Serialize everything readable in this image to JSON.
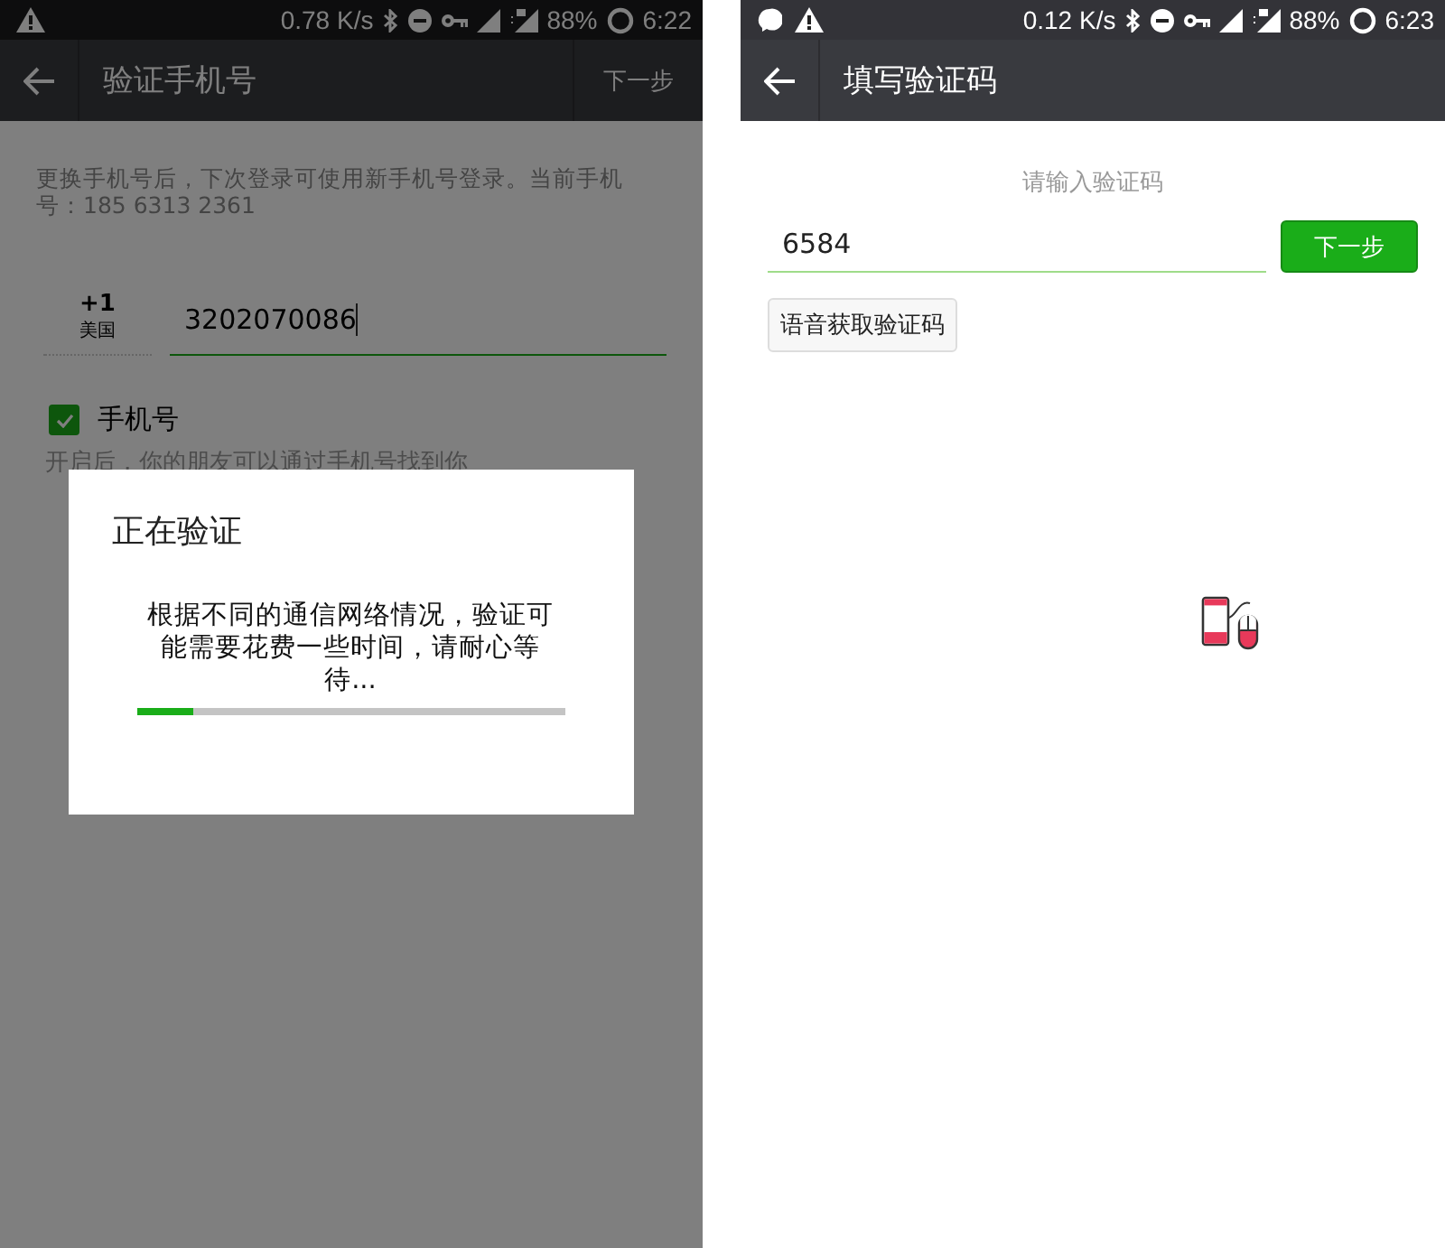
{
  "screens": [
    {
      "status_bar": {
        "speed": "0.78 K/s",
        "battery": "88%",
        "time": "6:22"
      },
      "toolbar": {
        "title": "验证手机号",
        "action": "下一步"
      },
      "description": "更换手机号后，下次登录可使用新手机号登录。当前手机号：185 6313 2361",
      "country": {
        "code": "+1",
        "name": "美国"
      },
      "phone_field": {
        "value": "3202070086"
      },
      "checkbox": {
        "label": "手机号",
        "checked": true
      },
      "hint": "开启后，你的朋友可以通过手机号找到你",
      "dialog": {
        "title": "正在验证",
        "message": "根据不同的通信网络情况，验证可能需要花费一些时间，请耐心等待...",
        "level": 0.13
      }
    },
    {
      "status_bar": {
        "speed": "0.12 K/s",
        "battery": "88%",
        "time": "6:23"
      },
      "toolbar": {
        "title": "填写验证码"
      },
      "prompt": "请输入验证码",
      "code_field": {
        "value": "6584"
      },
      "next_button": "下一步",
      "voice_button": "语音获取验证码"
    }
  ]
}
